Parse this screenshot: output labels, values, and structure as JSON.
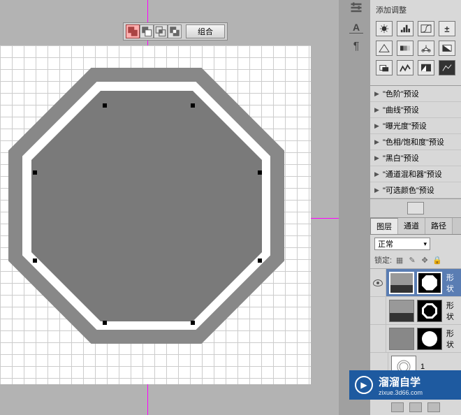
{
  "toolbar": {
    "combine_label": "组合"
  },
  "adjustments": {
    "title": "添加调整",
    "presets": [
      "\"色阶\"预设",
      "\"曲线\"预设",
      "\"曝光度\"预设",
      "\"色相/饱和度\"预设",
      "\"黑白\"预设",
      "\"通道混和器\"预设",
      "\"可选颜色\"预设"
    ]
  },
  "panel_tabs": {
    "layers": "图层",
    "channels": "通道",
    "paths": "路径"
  },
  "blend": {
    "mode": "正常",
    "lock_label": "锁定:"
  },
  "layers": [
    {
      "label": "形状",
      "visible": true,
      "selected": true,
      "mask": "octagon",
      "thumb_style": "dark-gradient"
    },
    {
      "label": "形状",
      "visible": false,
      "selected": false,
      "mask": "octagon-striped",
      "thumb_style": "dark-gradient"
    },
    {
      "label": "形状",
      "visible": false,
      "selected": false,
      "mask": "circle",
      "thumb_style": "solid"
    },
    {
      "label": "1",
      "visible": false,
      "selected": false,
      "mask": "none",
      "thumb_style": "white"
    }
  ],
  "watermark": {
    "brand": "溜溜自学",
    "domain": "zixue.3d66.com"
  },
  "icons": {
    "path_add": "add-to-selection",
    "path_subtract": "subtract-from-selection",
    "path_intersect": "intersect-selection",
    "path_exclude": "exclude-selection"
  }
}
